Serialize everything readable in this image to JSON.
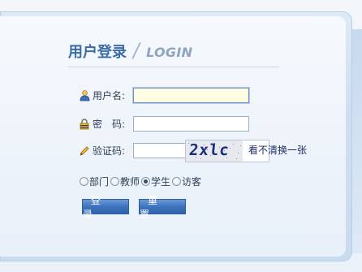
{
  "header": {
    "title_cn": "用户登录",
    "separator": "/",
    "title_en": "LOGIN"
  },
  "form": {
    "username": {
      "label": "用户名:",
      "value": "",
      "icon": "user-icon"
    },
    "password": {
      "label": "密　码:",
      "value": "",
      "icon": "lock-icon"
    },
    "captcha": {
      "label": "验证码:",
      "value": "",
      "icon": "pencil-icon",
      "image_text": "2xlc",
      "refresh_text": "看不清换一张"
    },
    "roles": [
      {
        "label": "部门",
        "checked": false
      },
      {
        "label": "教师",
        "checked": false
      },
      {
        "label": "学生",
        "checked": true
      },
      {
        "label": "访客",
        "checked": false
      }
    ],
    "buttons": {
      "login": "登 录",
      "reset": "重 置"
    }
  },
  "colors": {
    "accent": "#3a6ca8",
    "button": "#3e73bd",
    "focus_bg": "#fffde1"
  }
}
